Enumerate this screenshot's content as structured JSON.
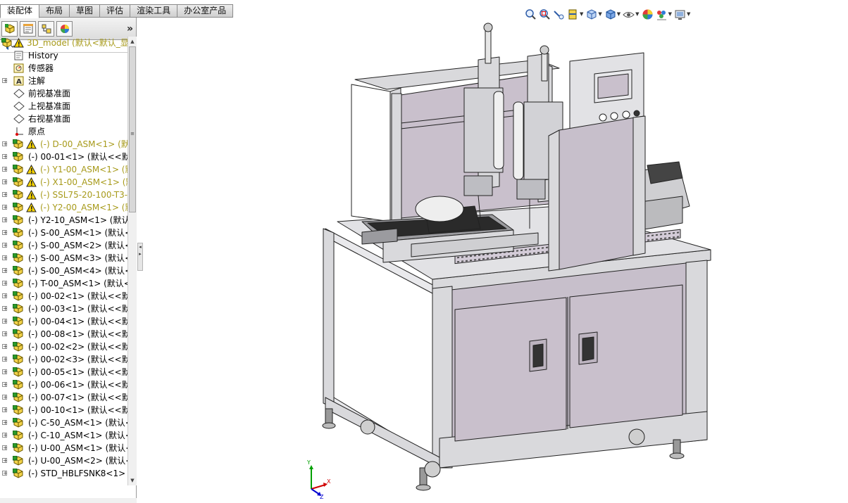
{
  "command_tabs": [
    {
      "label": "装配体",
      "active": true
    },
    {
      "label": "布局",
      "active": false
    },
    {
      "label": "草图",
      "active": false
    },
    {
      "label": "评估",
      "active": false
    },
    {
      "label": "渲染工具",
      "active": false
    },
    {
      "label": "办公室产品",
      "active": false
    }
  ],
  "panel_tabs": [
    "featuremanager-icon",
    "propertymanager-icon",
    "configurationmanager-icon",
    "displaymanager-icon"
  ],
  "tree": {
    "root": {
      "label": "3D_model  (默认<默认_显"
    },
    "items": [
      {
        "label": "History",
        "icon": "history-icon",
        "warn": false,
        "expand": false
      },
      {
        "label": "传感器",
        "icon": "sensor-icon",
        "warn": false,
        "expand": false
      },
      {
        "label": "注解",
        "icon": "annotation-icon",
        "warn": false,
        "expand": true
      },
      {
        "label": "前视基准面",
        "icon": "plane-icon",
        "warn": false,
        "expand": false
      },
      {
        "label": "上视基准面",
        "icon": "plane-icon",
        "warn": false,
        "expand": false
      },
      {
        "label": "右视基准面",
        "icon": "plane-icon",
        "warn": false,
        "expand": false
      },
      {
        "label": "原点",
        "icon": "origin-icon",
        "warn": false,
        "expand": false
      },
      {
        "label": "(-) D-00_ASM<1> (默",
        "icon": "assembly-icon",
        "warn": true,
        "expand": true
      },
      {
        "label": "(-) 00-01<1> (默认<<默",
        "icon": "assembly-icon",
        "warn": false,
        "expand": true
      },
      {
        "label": "(-) Y1-00_ASM<1> (默",
        "icon": "assembly-icon",
        "warn": true,
        "expand": true
      },
      {
        "label": "(-) X1-00_ASM<1> (默",
        "icon": "assembly-icon",
        "warn": true,
        "expand": true
      },
      {
        "label": "(-) SSL75-20-100-T3-I",
        "icon": "assembly-icon",
        "warn": true,
        "expand": true
      },
      {
        "label": "(-) Y2-00_ASM<1> (默",
        "icon": "assembly-icon",
        "warn": true,
        "expand": true
      },
      {
        "label": "(-) Y2-10_ASM<1> (默认",
        "icon": "assembly-icon",
        "warn": false,
        "expand": true
      },
      {
        "label": "(-) S-00_ASM<1> (默认<",
        "icon": "assembly-icon",
        "warn": false,
        "expand": true
      },
      {
        "label": "(-) S-00_ASM<2> (默认<",
        "icon": "assembly-icon",
        "warn": false,
        "expand": true
      },
      {
        "label": "(-) S-00_ASM<3> (默认<",
        "icon": "assembly-icon",
        "warn": false,
        "expand": true
      },
      {
        "label": "(-) S-00_ASM<4> (默认<",
        "icon": "assembly-icon",
        "warn": false,
        "expand": true
      },
      {
        "label": "(-) T-00_ASM<1> (默认<",
        "icon": "assembly-icon",
        "warn": false,
        "expand": true
      },
      {
        "label": "(-) 00-02<1> (默认<<默",
        "icon": "assembly-icon",
        "warn": false,
        "expand": true
      },
      {
        "label": "(-) 00-03<1> (默认<<默",
        "icon": "assembly-icon",
        "warn": false,
        "expand": true
      },
      {
        "label": "(-) 00-04<1> (默认<<默",
        "icon": "assembly-icon",
        "warn": false,
        "expand": true
      },
      {
        "label": "(-) 00-08<1> (默认<<默",
        "icon": "assembly-icon",
        "warn": false,
        "expand": true
      },
      {
        "label": "(-) 00-02<2> (默认<<默",
        "icon": "assembly-icon",
        "warn": false,
        "expand": true
      },
      {
        "label": "(-) 00-02<3> (默认<<默",
        "icon": "assembly-icon",
        "warn": false,
        "expand": true
      },
      {
        "label": "(-) 00-05<1> (默认<<默",
        "icon": "assembly-icon",
        "warn": false,
        "expand": true
      },
      {
        "label": "(-) 00-06<1> (默认<<默",
        "icon": "assembly-icon",
        "warn": false,
        "expand": true
      },
      {
        "label": "(-) 00-07<1> (默认<<默",
        "icon": "assembly-icon",
        "warn": false,
        "expand": true
      },
      {
        "label": "(-) 00-10<1> (默认<<默",
        "icon": "assembly-icon",
        "warn": false,
        "expand": true
      },
      {
        "label": "(-) C-50_ASM<1> (默认<",
        "icon": "assembly-icon",
        "warn": false,
        "expand": true
      },
      {
        "label": "(-) C-10_ASM<1> (默认<",
        "icon": "assembly-icon",
        "warn": false,
        "expand": true
      },
      {
        "label": "(-) U-00_ASM<1> (默认<",
        "icon": "assembly-icon",
        "warn": false,
        "expand": true
      },
      {
        "label": "(-) U-00_ASM<2> (默认<",
        "icon": "assembly-icon",
        "warn": false,
        "expand": true
      },
      {
        "label": "(-) STD_HBLFSNK8<1> (",
        "icon": "assembly-icon",
        "warn": false,
        "expand": true
      }
    ]
  },
  "hud_tools": [
    "zoom-to-fit-icon",
    "zoom-to-area-icon",
    "previous-view-icon",
    "section-view-icon",
    "view-orientation-icon",
    "display-style-icon",
    "hide-show-items-icon",
    "edit-appearance-icon",
    "apply-scene-icon",
    "view-settings-icon"
  ],
  "triad": {
    "x": "X",
    "y": "Y",
    "z": "Z"
  },
  "colors": {
    "machine_panel": "#c9c0cc",
    "frame": "#d9d9dc",
    "warning_text": "#a79a1a",
    "triad_x": "#d00000",
    "triad_y": "#00a000",
    "triad_z": "#0000d0"
  }
}
